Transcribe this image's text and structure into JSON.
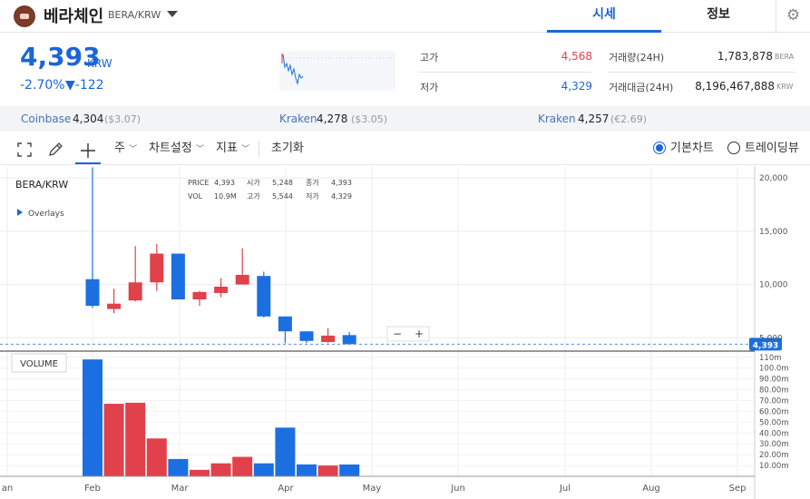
{
  "header": {
    "coin_name": "베라체인",
    "pair": "BERA/KRW",
    "tabs": [
      "시세",
      "정보"
    ],
    "settings_icon": "gear-icon"
  },
  "price": {
    "value": "4,393",
    "unit": "KRW",
    "change_rate": "-2.70%",
    "change_amount": "▼-122",
    "color": "#1c65d6"
  },
  "stats": {
    "high_label": "고가",
    "high_value": "4,568",
    "low_label": "저가",
    "low_value": "4,329",
    "volume_label": "거래량(24H)",
    "volume_value": "1,783,878",
    "volume_unit": "BERA",
    "amount_label": "거래대금(24H)",
    "amount_value": "8,196,467,888",
    "amount_unit": "KRW"
  },
  "exchanges": [
    {
      "name": "Coinbase",
      "price": "4,304",
      "sub": "($3.07)"
    },
    {
      "name": "Kraken",
      "price": "4,278",
      "sub": "($3.05)"
    },
    {
      "name": "Kraken",
      "price": "4,257",
      "sub": "(€2.69)"
    }
  ],
  "toolbar": {
    "period": "주",
    "chart_settings": "차트설정",
    "indicators": "지표",
    "reset": "초기화",
    "basic_chart": "기본차트",
    "trading_view": "트레이딩뷰"
  },
  "chart_data": {
    "type": "candlestick",
    "symbol": "BERA/KRW",
    "overlays_label": "Overlays",
    "volume_label": "VOLUME",
    "legend": {
      "price_label": "PRICE",
      "price": "4,393",
      "open_label": "시가",
      "open": "5,248",
      "close_label": "종가",
      "close": "4,393",
      "vol_label": "VOL",
      "vol": "10.9M",
      "high_label": "고가",
      "high": "5,544",
      "low_label": "저가",
      "low": "4,329"
    },
    "x_ticks": [
      "an",
      "Feb",
      "Mar",
      "Apr",
      "May",
      "Jun",
      "Jul",
      "Aug",
      "Sep"
    ],
    "y_ticks": [
      "20,000",
      "15,000",
      "10,000",
      "5,000"
    ],
    "y_range": [
      4000,
      20700
    ],
    "volume_ticks": [
      "110m",
      "100.0m",
      "90.00m",
      "80.00m",
      "70.00m",
      "60.00m",
      "50.00m",
      "40.00m",
      "30.00m",
      "20.00m",
      "10.00m"
    ],
    "volume_range": [
      0,
      114
    ],
    "current_price_label": "4,393",
    "current_price": 4393,
    "up_color": "#e0414a",
    "down_color": "#1c6fe0",
    "candles": [
      {
        "open": 10500,
        "close": 8000,
        "high": 21000,
        "low": 7800,
        "volume": 108
      },
      {
        "open": 7700,
        "close": 8200,
        "high": 9600,
        "low": 7300,
        "volume": 67
      },
      {
        "open": 8500,
        "close": 10200,
        "high": 13600,
        "low": 8400,
        "volume": 68
      },
      {
        "open": 10200,
        "close": 12900,
        "high": 13800,
        "low": 9400,
        "volume": 35
      },
      {
        "open": 12900,
        "close": 8600,
        "high": 12900,
        "low": 8600,
        "volume": 16
      },
      {
        "open": 8600,
        "close": 9300,
        "high": 9400,
        "low": 8000,
        "volume": 6
      },
      {
        "open": 9200,
        "close": 9800,
        "high": 10600,
        "low": 8800,
        "volume": 12
      },
      {
        "open": 10000,
        "close": 10900,
        "high": 13400,
        "low": 10000,
        "volume": 18
      },
      {
        "open": 10800,
        "close": 7000,
        "high": 11200,
        "low": 6900,
        "volume": 12
      },
      {
        "open": 7000,
        "close": 5600,
        "high": 7000,
        "low": 4500,
        "volume": 45
      },
      {
        "open": 5600,
        "close": 4700,
        "high": 5600,
        "low": 4500,
        "volume": 11
      },
      {
        "open": 4600,
        "close": 5200,
        "high": 5900,
        "low": 4500,
        "volume": 10
      },
      {
        "open": 5248,
        "close": 4393,
        "high": 5544,
        "low": 4329,
        "volume": 10.9
      }
    ]
  }
}
